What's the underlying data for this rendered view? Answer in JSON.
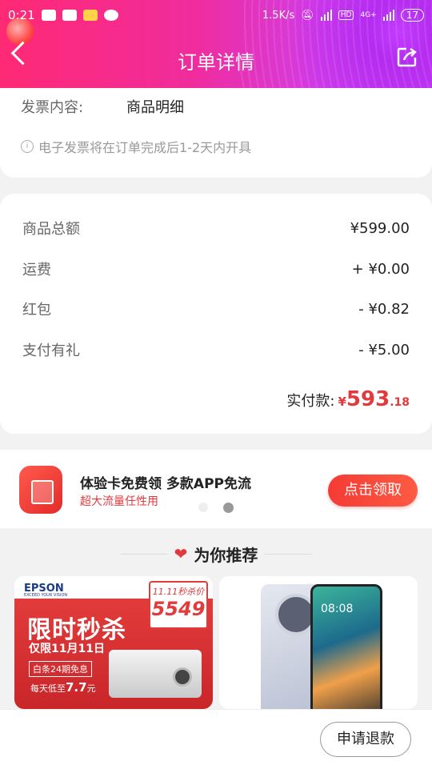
{
  "status_bar": {
    "time": "0:21",
    "speed": "1.5K/s",
    "network": "4G+",
    "battery": "17"
  },
  "header": {
    "title": "订单详情"
  },
  "invoice": {
    "label": "发票内容:",
    "value": "商品明细",
    "note": "电子发票将在订单完成后1-2天内开具"
  },
  "summary": {
    "rows": [
      {
        "label": "商品总额",
        "value": "¥599.00"
      },
      {
        "label": "运费",
        "value": "+ ¥0.00"
      },
      {
        "label": "红包",
        "value": "- ¥0.82"
      },
      {
        "label": "支付有礼",
        "value": "- ¥5.00"
      }
    ],
    "paid_label": "实付款:",
    "paid_currency": "¥",
    "paid_integer": "593",
    "paid_decimal": ".18"
  },
  "promo": {
    "title": "体验卡免费领 多款APP免流",
    "subtitle": "超大流量任性用",
    "button": "点击领取"
  },
  "recommend": {
    "title": "为你推荐"
  },
  "products": [
    {
      "brand": "EPSON",
      "brand_sub": "EXCEED YOUR VISION",
      "headline": "限时秒杀",
      "date_line": "仅限11月11日",
      "tag_top": "11.11秒杀价",
      "tag_price": "5549",
      "badge": "白条24期免息",
      "daily_prefix": "每天低至",
      "daily_amount": "7.7",
      "daily_unit": "元"
    },
    {
      "screen_time": "08:08"
    }
  ],
  "bottom": {
    "refund_button": "申请退款"
  },
  "colors": {
    "accent": "#e4393c",
    "header_start": "#ff2a74",
    "header_end": "#c73cf3"
  }
}
